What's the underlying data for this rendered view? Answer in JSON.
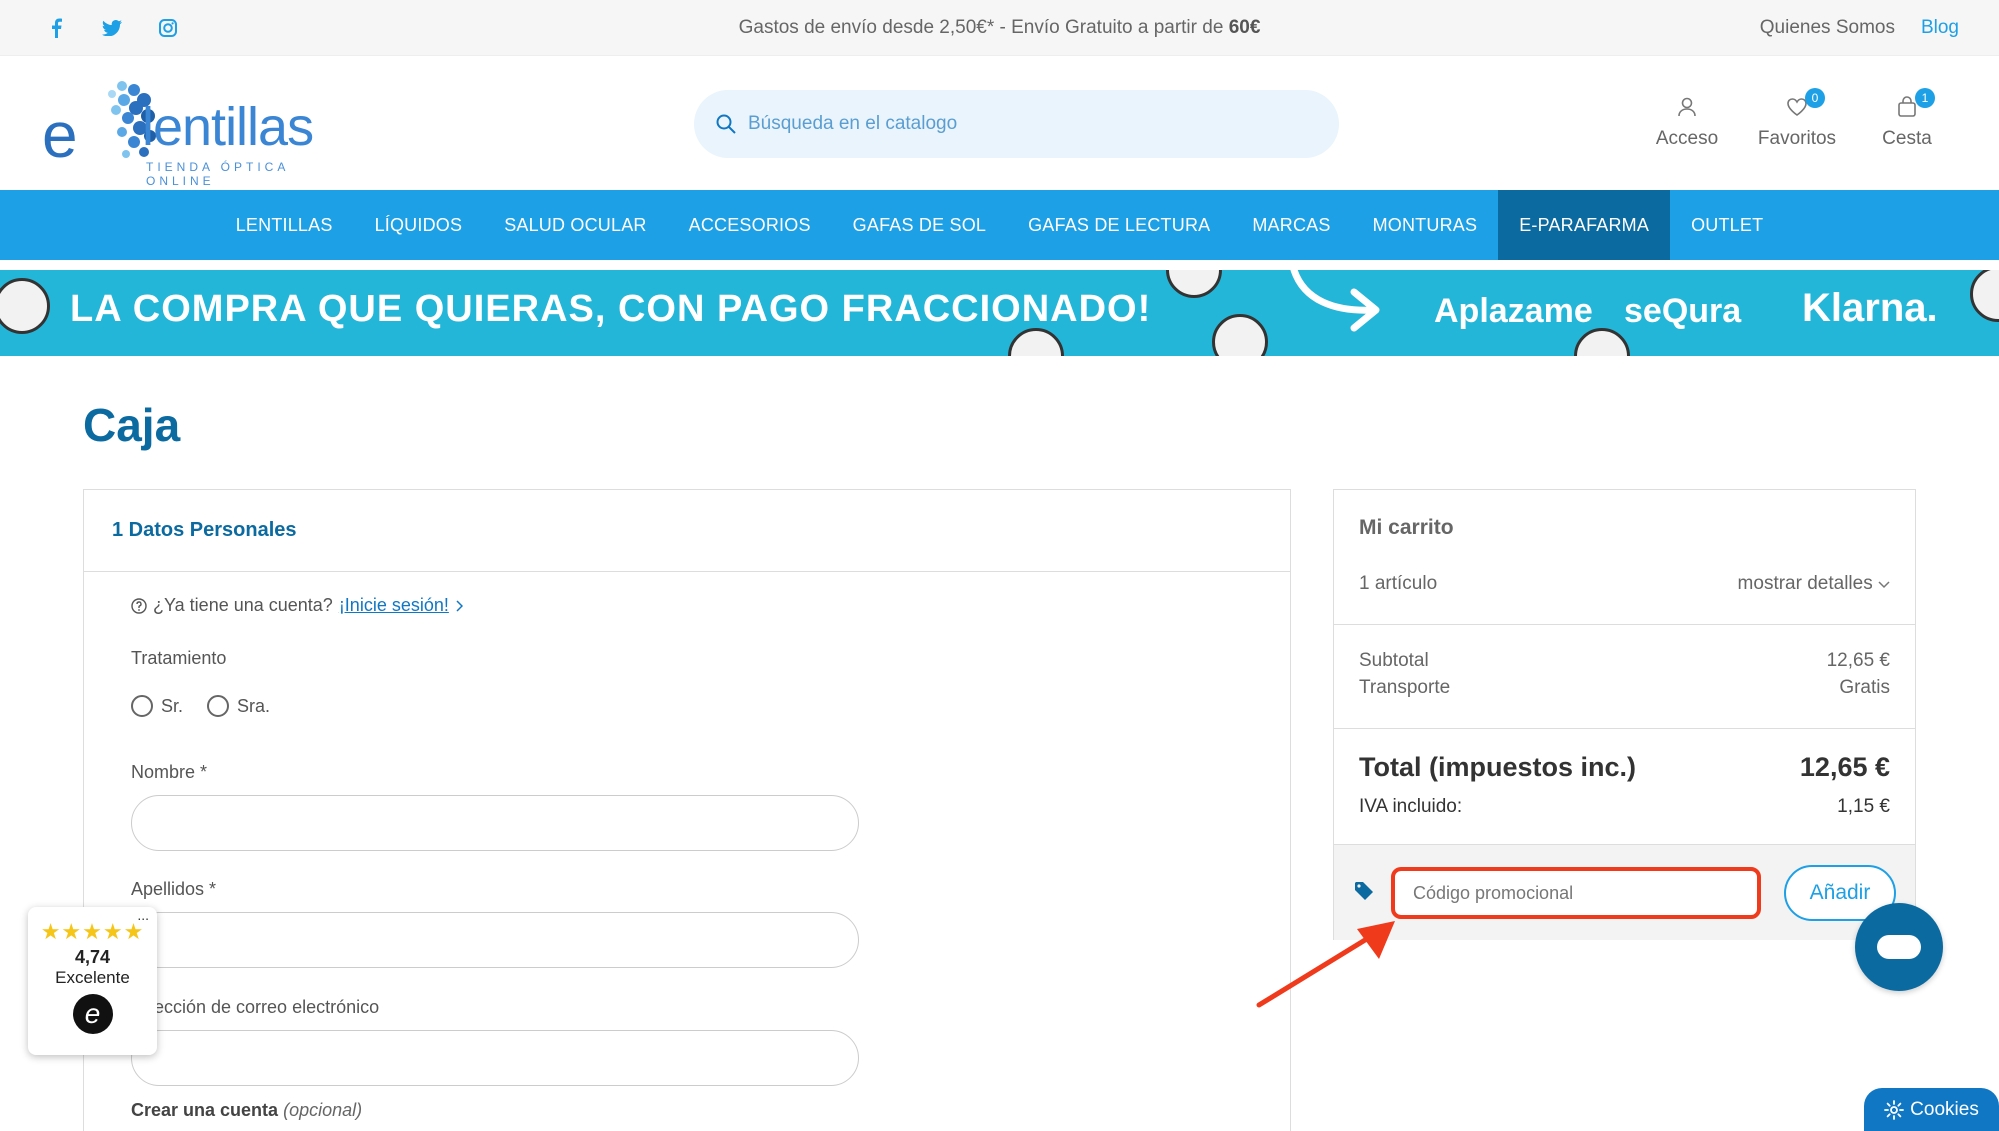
{
  "topbar": {
    "message_pre": "Gastos de envío desde 2,50€* - Envío Gratuito a partir de ",
    "message_bold": "60€",
    "links": [
      "Quienes Somos",
      "Blog"
    ],
    "social_icons": [
      "facebook-icon",
      "twitter-icon",
      "instagram-icon"
    ]
  },
  "header": {
    "logo_text": "lentillas",
    "logo_e": "e",
    "logo_sub": "TIENDA ÓPTICA ONLINE",
    "search_placeholder": "Búsqueda en el catalogo",
    "account": "Acceso",
    "favorites": "Favoritos",
    "favorites_count": "0",
    "cart": "Cesta",
    "cart_count": "1"
  },
  "nav": {
    "items": [
      "LENTILLAS",
      "LÍQUIDOS",
      "SALUD OCULAR",
      "ACCESORIOS",
      "GAFAS DE SOL",
      "GAFAS DE LECTURA",
      "MARCAS",
      "MONTURAS",
      "E-PARAFARMA",
      "OUTLET"
    ],
    "active": "E-PARAFARMA"
  },
  "banner": {
    "text": "LA COMPRA QUE QUIERAS, CON PAGO FRACCIONADO!",
    "brands": [
      "Aplazame",
      "seQura",
      "Klarna."
    ]
  },
  "page": {
    "title": "Caja"
  },
  "personal": {
    "heading": "1 Datos Personales",
    "login_question": "¿Ya tiene una cuenta?",
    "login_link": "¡Inicie sesión!",
    "treatment_label": "Tratamiento",
    "treatment_options": [
      "Sr.",
      "Sra."
    ],
    "name_label": "Nombre *",
    "surname_label": "Apellidos *",
    "email_label": "Dirección de correo electrónico",
    "create_account_bold": "Crear una cuenta",
    "create_account_optional": "(opcional)"
  },
  "cart": {
    "title": "Mi carrito",
    "items_count": "1 artículo",
    "show_details": "mostrar detalles",
    "subtotal_label": "Subtotal",
    "subtotal_value": "12,65 €",
    "shipping_label": "Transporte",
    "shipping_value": "Gratis",
    "total_label": "Total (impuestos inc.)",
    "total_value": "12,65 €",
    "vat_label": "IVA incluido:",
    "vat_value": "1,15 €",
    "promo_placeholder": "Código promocional",
    "promo_button": "Añadir"
  },
  "trust": {
    "stars": "★★★★★",
    "score": "4,74",
    "label": "Excelente",
    "mark": "e",
    "menu": "..."
  },
  "cookies": {
    "label": "Cookies"
  },
  "colors": {
    "primary": "#1da0e6",
    "dark": "#0b6aa0",
    "highlight": "#f03a1c",
    "banner": "#23b6d8"
  }
}
